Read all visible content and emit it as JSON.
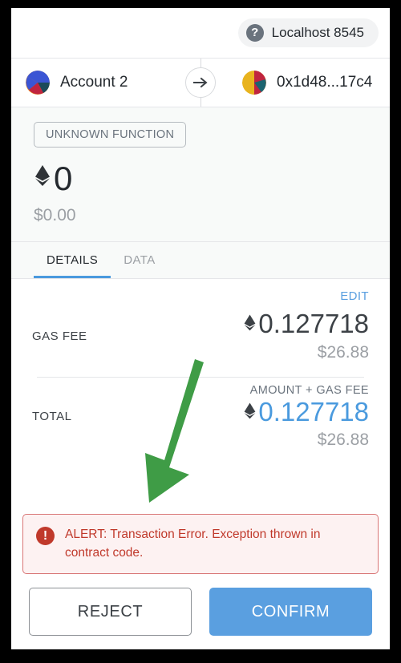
{
  "network": {
    "help_icon": "question-mark-icon",
    "label": "Localhost 8545"
  },
  "accounts": {
    "from_name": "Account 2",
    "to_name": "0x1d48...17c4",
    "transfer_icon": "arrow-right-icon"
  },
  "summary": {
    "function_badge": "UNKNOWN FUNCTION",
    "currency_icon": "ethereum-diamond-icon",
    "amount": "0",
    "amount_fiat": "$0.00"
  },
  "tabs": [
    {
      "label": "DETAILS",
      "active": true
    },
    {
      "label": "DATA",
      "active": false
    }
  ],
  "details": {
    "edit_label": "EDIT",
    "gas_fee": {
      "label": "GAS FEE",
      "amount": "0.127718",
      "fiat": "$26.88"
    },
    "total": {
      "label": "TOTAL",
      "sublabel": "AMOUNT + GAS FEE",
      "amount": "0.127718",
      "fiat": "$26.88"
    }
  },
  "alert": {
    "icon": "error-exclamation-icon",
    "message": "ALERT: Transaction Error. Exception thrown in contract code."
  },
  "footer": {
    "reject_label": "REJECT",
    "confirm_label": "CONFIRM"
  },
  "colors": {
    "accent_blue": "#4a9ade",
    "confirm_blue": "#5a9fe0",
    "alert_red": "#c0392b",
    "alert_bg": "#fdf2f2",
    "annotation_green": "#3f9c46",
    "summary_bg": "#f8faf9"
  },
  "annotation": {
    "arrow": "green-pointer-arrow"
  }
}
